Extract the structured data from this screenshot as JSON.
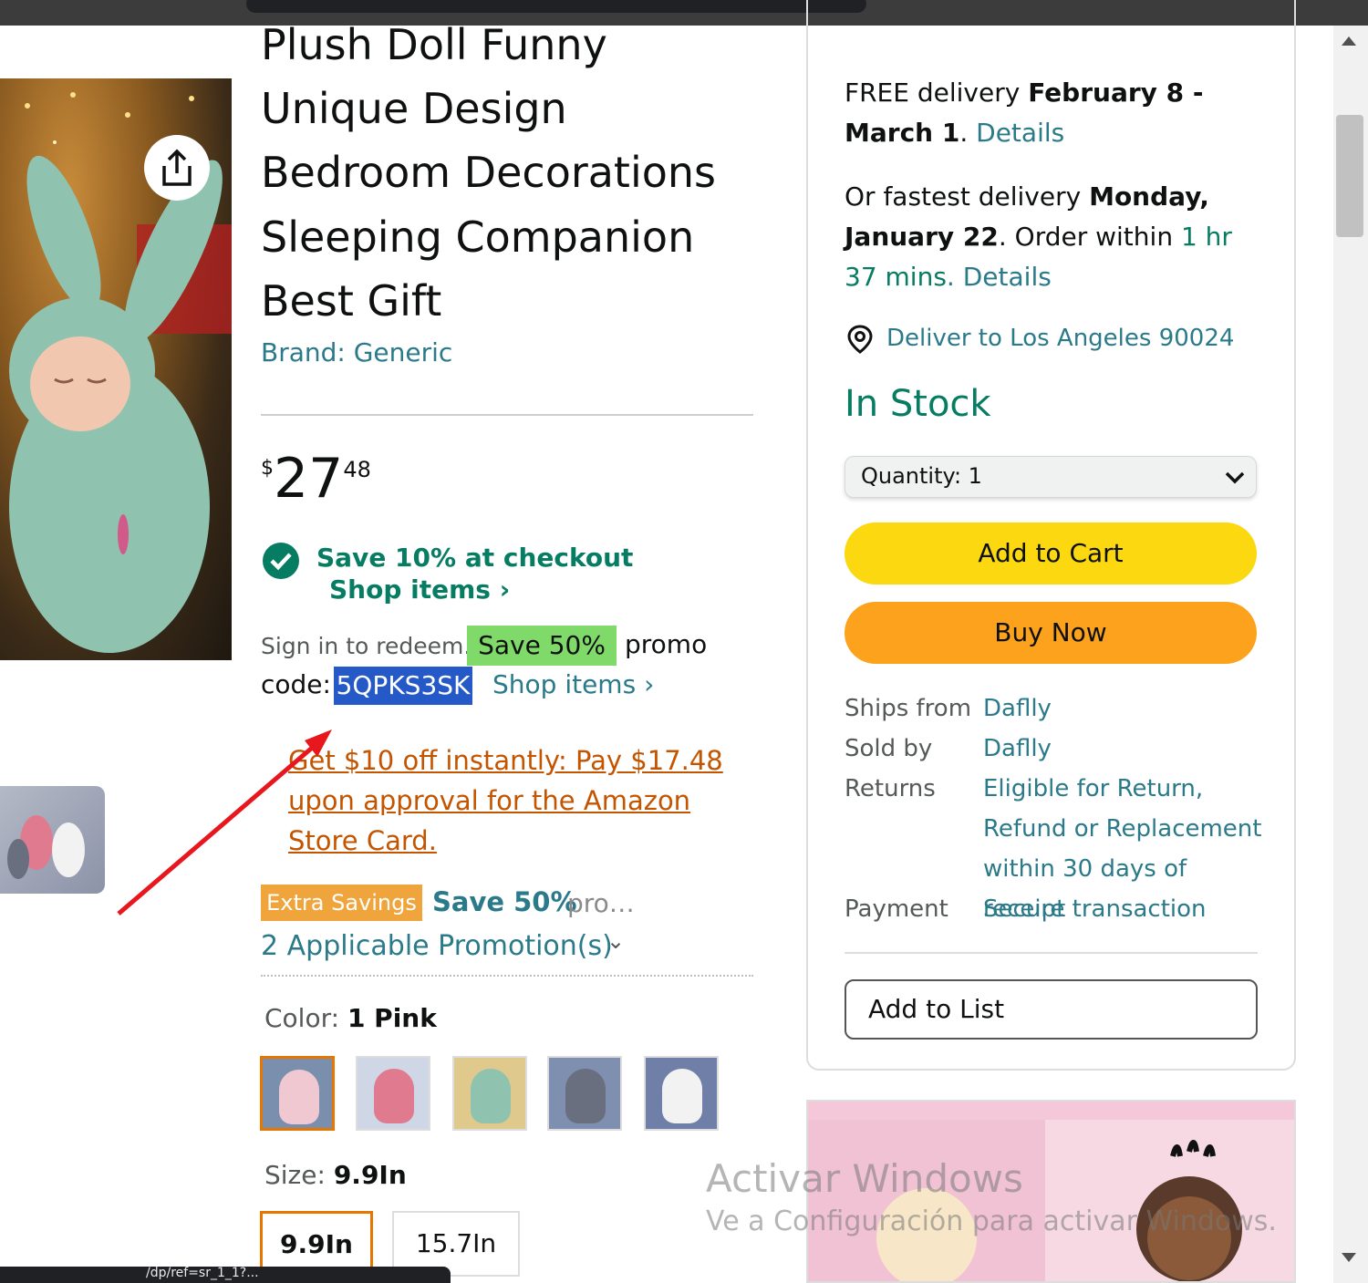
{
  "product": {
    "title_lines": [
      "Plush Doll Funny",
      "Unique Design",
      "Bedroom Decorations",
      "Sleeping Companion",
      "Best Gift"
    ],
    "brand": "Brand: Generic",
    "price": {
      "symbol": "$",
      "whole": "27",
      "fraction": "48"
    }
  },
  "offers": {
    "checkout_save": "Save 10% at checkout",
    "shop_items_1": "Shop items ›",
    "sign_in": "Sign in to redeem.",
    "promo_badge": "Save 50%",
    "promo_word": "promo",
    "code_label": "code:",
    "code_value": "5QPKS3SK",
    "shop_items_2": "Shop items ›",
    "store_card": "Get $10 off instantly: Pay $17.48 upon approval for the Amazon Store Card.",
    "extra_badge": "Extra Savings",
    "extra_save": "Save 50%",
    "extra_more": "pro…",
    "applicable": "2 Applicable Promotion(s)"
  },
  "color": {
    "label": "Color:",
    "value": "1 Pink",
    "swatch_count": 5,
    "selected_index": 0
  },
  "size": {
    "label": "Size:",
    "value": "9.9In",
    "options": [
      "9.9In",
      "15.7In"
    ],
    "selected_index": 0
  },
  "buybox": {
    "delivery_prefix": "FREE delivery ",
    "delivery_dates": "February 8 - March 1",
    "details": "Details",
    "fastest_prefix": "Or fastest delivery ",
    "fastest_date": "Monday, January 22",
    "order_within": ". Order within ",
    "order_time": "1 hr 37 mins",
    "deliver_to": "Deliver to Los Angeles 90024",
    "stock": "In Stock",
    "quantity": "Quantity:  1",
    "add_to_cart": "Add to Cart",
    "buy_now": "Buy Now",
    "info": [
      {
        "key": "Ships from",
        "value": "Daflly"
      },
      {
        "key": "Sold by",
        "value": "Daflly"
      },
      {
        "key": "Returns",
        "value": "Eligible for Return, Refund or Replacement within 30 days of receipt"
      },
      {
        "key": "Payment",
        "value": "Secure transaction"
      }
    ],
    "add_to_list": "Add to List"
  },
  "watermark": {
    "line1": "Activar Windows",
    "line2": "Ve a Configuración para activar Windows."
  },
  "status_url": "/dp/ref=sr_1_1?...",
  "colors": {
    "accent_teal": "#2a7a8a",
    "green": "#067d62",
    "cart_yellow": "#fcd811",
    "buy_orange": "#fca21c",
    "selected_orange": "#e77600",
    "annotation_red": "#e8161d"
  }
}
